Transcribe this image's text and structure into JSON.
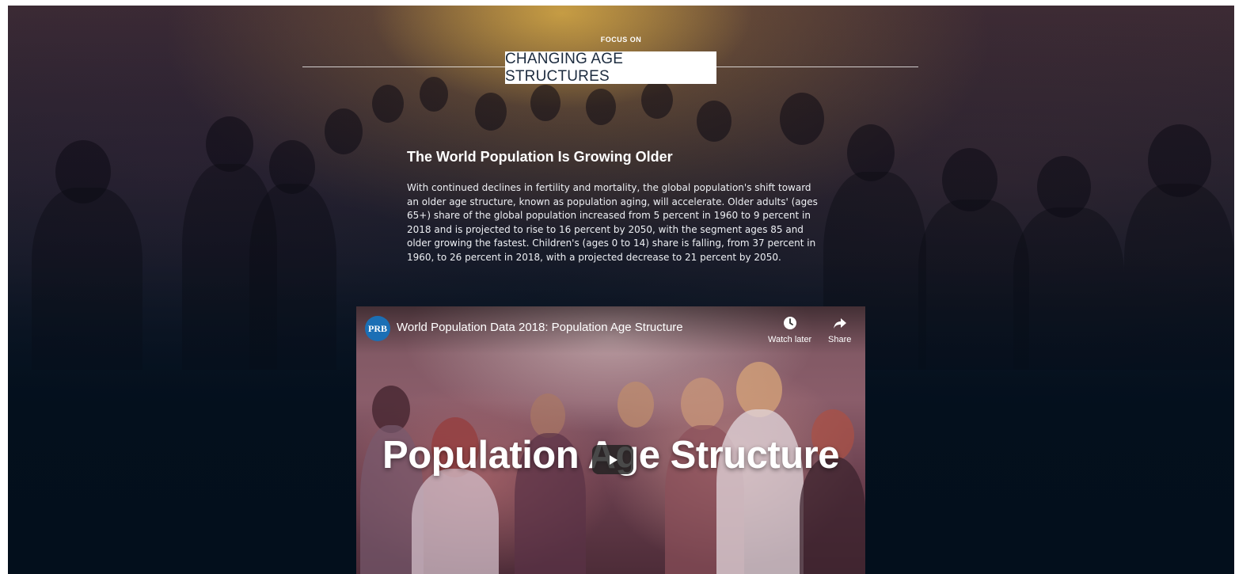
{
  "hero": {
    "focus_label": "FOCUS ON",
    "section_title": "CHANGING AGE STRUCTURES"
  },
  "article": {
    "heading": "The World Population Is Growing Older",
    "paragraph": "With continued declines in fertility and mortality, the global population's shift toward an older age structure, known as population aging, will accelerate. Older adults' (ages 65+) share of the global population increased from 5 percent in 1960 to 9 percent in 2018 and is projected to rise to 16 percent by 2050, with the segment ages 85 and older growing the fastest. Children's (ages 0 to 14) share is falling, from 37 percent in 1960, to 26 percent in 2018, with a projected decrease to 21 percent by 2050."
  },
  "video": {
    "channel_logo": "PRB",
    "title": "World Population Data 2018: Population Age Structure",
    "watch_later_label": "Watch later",
    "share_label": "Share",
    "overlay_title": "Population Age Structure",
    "icons": {
      "watch_later": "clock-icon",
      "share": "share-arrow-icon",
      "play": "play-icon"
    }
  },
  "colors": {
    "title_box_bg": "#ffffff",
    "title_text": "#1d2c3f",
    "page_bottom": "#05121f",
    "youtube_play_bg": "#212121",
    "prb_blue": "#1b6fb5"
  }
}
